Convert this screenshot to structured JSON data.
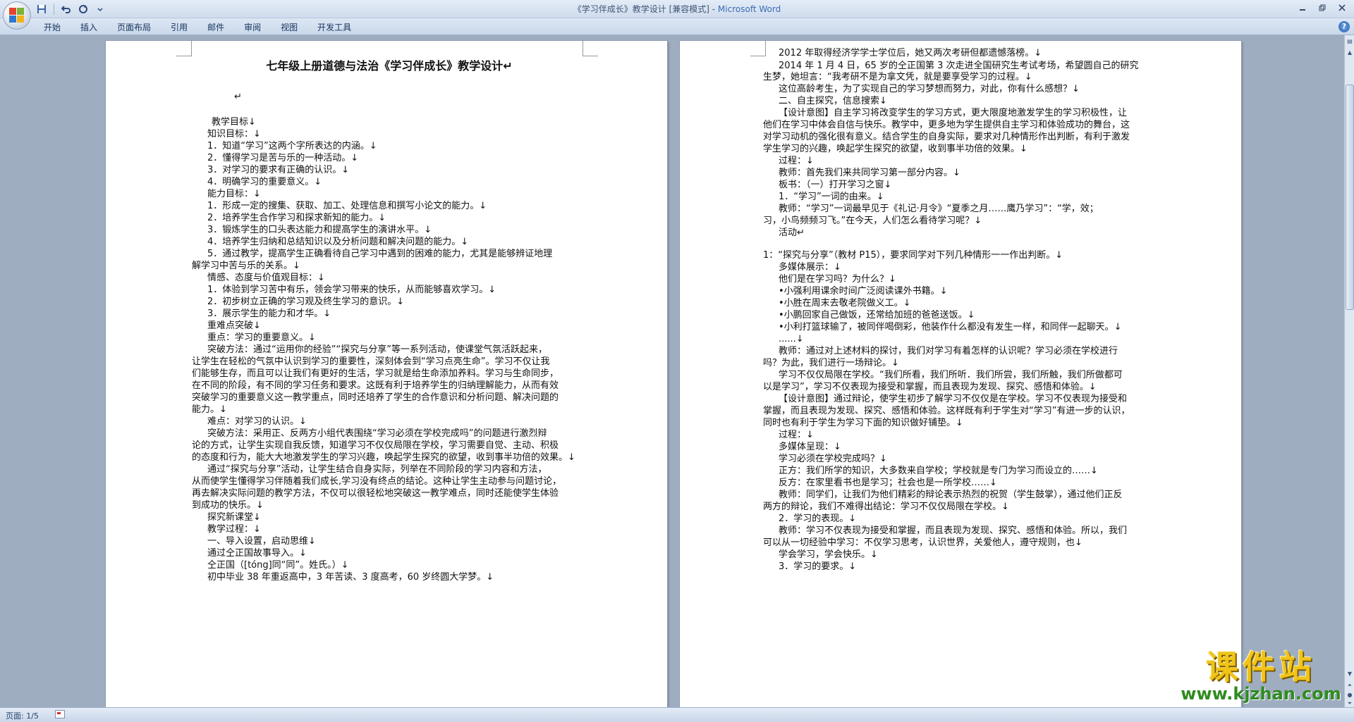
{
  "window": {
    "title_doc": "《学习伴成长》教学设计 [兼容模式] - ",
    "title_app": "Microsoft Word"
  },
  "ribbon": {
    "tabs": [
      "开始",
      "插入",
      "页面布局",
      "引用",
      "邮件",
      "审阅",
      "视图",
      "开发工具"
    ]
  },
  "icons": {
    "office": "office-button-icon",
    "save": "save-icon",
    "undo": "undo-icon",
    "redo": "redo-icon",
    "customize": "chevron-down-icon",
    "help": "help-icon"
  },
  "page_left": {
    "title": "七年级上册道德与法治《学习伴成长》教学设计↵",
    "lines": [
      "↵",
      "教学目标↓",
      "知识目标：↓",
      "1．知道“学习”这两个字所表达的内涵。↓",
      "2．懂得学习是苦与乐的一种活动。↓",
      "3．对学习的要求有正确的认识。↓",
      "4．明确学习的重要意义。↓",
      "能力目标：↓",
      "1．形成一定的搜集、获取、加工、处理信息和撰写小论文的能力。↓",
      "2．培养学生合作学习和探求新知的能力。↓",
      "3．锻炼学生的口头表达能力和提高学生的演讲水平。↓",
      "4．培养学生归纳和总结知识以及分析问题和解决问题的能力。↓",
      "5．通过教学，提高学生正确看待自己学习中遇到的困难的能力，尤其是能够辨证地理",
      "解学习中苦与乐的关系。↓",
      "情感、态度与价值观目标：↓",
      "1．体验到学习苦中有乐，领会学习带来的快乐，从而能够喜欢学习。↓",
      "2．初步树立正确的学习观及终生学习的意识。↓",
      "3．展示学生的能力和才华。↓",
      "重难点突破↓",
      "重点：学习的重要意义。↓",
      "突破方法：通过“运用你的经验”“探究与分享”等一系列活动，使课堂气氛活跃起来，",
      "让学生在轻松的气氛中认识到学习的重要性，深刻体会到“学习点亮生命”。学习不仅让我",
      "们能够生存，而且可以让我们有更好的生活，学习就是给生命添加养料。学习与生命同步，",
      "在不同的阶段，有不同的学习任务和要求。这既有利于培养学生的归纳理解能力，从而有效",
      "突破学习的重要意义这一教学重点，同时还培养了学生的合作意识和分析问题、解决问题的",
      "能力。↓",
      "难点：对学习的认识。↓",
      "突破方法：采用正、反两方小组代表围绕“学习必须在学校完成吗”的问题进行激烈辩",
      "论的方式，让学生实现自我反馈，知道学习不仅仅局限在学校，学习需要自觉、主动、积极",
      "的态度和行为，能大大地激发学生的学习兴趣，唤起学生探究的欲望，收到事半功倍的效果。↓",
      "通过“探究与分享”活动，让学生结合自身实际，列举在不同阶段的学习内容和方法，",
      "从而使学生懂得学习伴随着我们成长,学习没有终点的结论。这种让学生主动参与问题讨论，",
      "再去解决实际问题的教学方法，不仅可以很轻松地突破这一教学难点，同时还能使学生体验",
      "到成功的快乐。↓",
      "探究新课堂↓",
      "教学过程：↓",
      "一、导入设置，启动思维↓",
      "通过仝正国故事导入。↓",
      "仝正国（[tóng]同“同”。姓氏。）↓",
      "初中毕业 38 年重返高中，3 年苦读、3 度高考，60 岁终圆大学梦。↓"
    ]
  },
  "page_right": {
    "lines": [
      "2012 年取得经济学学士学位后，她又两次考研但都遗憾落榜。↓",
      "2014 年 1 月 4 日，65 岁的仝正国第 3 次走进全国研究生考试考场，希望圆自己的研究",
      "生梦，她坦言：“我考研不是为拿文凭，就是要享受学习的过程。↓",
      "这位高龄考生，为了实现自己的学习梦想而努力，对此，你有什么感想？↓",
      "二、自主探究，信息搜索↓",
      "【设计意图】自主学习将改变学生的学习方式，更大限度地激发学生的学习积极性，让",
      "他们在学习中体会自信与快乐。教学中，更多地为学生提供自主学习和体验成功的舞台，这",
      "对学习动机的强化很有意义。结合学生的自身实际，要求对几种情形作出判断，有利于激发",
      "学生学习的兴趣，唤起学生探究的欲望，收到事半功倍的效果。↓",
      "过程：↓",
      "教师：首先我们来共同学习第一部分内容。↓",
      "板书：（一）打开学习之窗↓",
      "1．“学习”一词的由来。↓",
      "教师：“学习”一词最早见于《礼记·月令》“夏季之月……鹰乃学习”：“学，效；",
      "习，小鸟频频习飞。”在今天，人们怎么看待学习呢？↓",
      "活动↵",
      "1：“探究与分享”（教材 P15），要求同学对下列几种情形一一作出判断。↓",
      "多媒体展示：↓",
      "他们是在学习吗？为什么？↓",
      "•小强利用课余时间广泛阅读课外书籍。↓",
      "•小胜在周末去敬老院做义工。↓",
      "•小鹏回家自己做饭，还常给加班的爸爸送饭。↓",
      "•小利打篮球输了，被同伴喝倒彩，他装作什么都没有发生一样，和同伴一起聊天。↓",
      "......↓",
      "教师：通过对上述材料的探讨，我们对学习有着怎样的认识呢？学习必须在学校进行",
      "吗？为此，我们进行一场辩论。↓",
      "学习不仅仅局限在学校。“我们所看，我们所听．我们所尝，我们所触，我们所做都可",
      "以是学习”，学习不仅表现为接受和掌握，而且表现为发现、探究、感悟和体验。↓",
      "【设计意图】通过辩论，使学生初步了解学习不仅仅是在学校。学习不仅表现为接受和",
      "掌握，而且表现为发现、探究、感悟和体验。这样既有利于学生对“学习”有进一步的认识，",
      "同时也有利于学生为学习下面的知识做好铺垫。↓",
      "过程：↓",
      "多媒体呈现：↓",
      "学习必须在学校完成吗？↓",
      "正方：我们所学的知识，大多数来自学校；学校就是专门为学习而设立的……↓",
      "反方：在家里看书也是学习；社会也是一所学校……↓",
      "教师：同学们，让我们为他们精彩的辩论表示热烈的祝贺（学生鼓掌），通过他们正反",
      "两方的辩论，我们不难得出结论：学习不仅仅局限在学校。↓",
      "2．学习的表现。↓",
      "教师：学习不仅表现为接受和掌握，而且表现为发现、探究、感悟和体验。所以，我们",
      "可以从一切经验中学习：不仅学习思考，认识世界，关爱他人，遵守规则，也↓",
      "学会学习，学会快乐。↓",
      "3．学习的要求。↓"
    ]
  },
  "statusbar": {
    "page": "页面: 1/5"
  },
  "watermark": {
    "title": "课件站",
    "url": "www.kjzhan.com"
  }
}
